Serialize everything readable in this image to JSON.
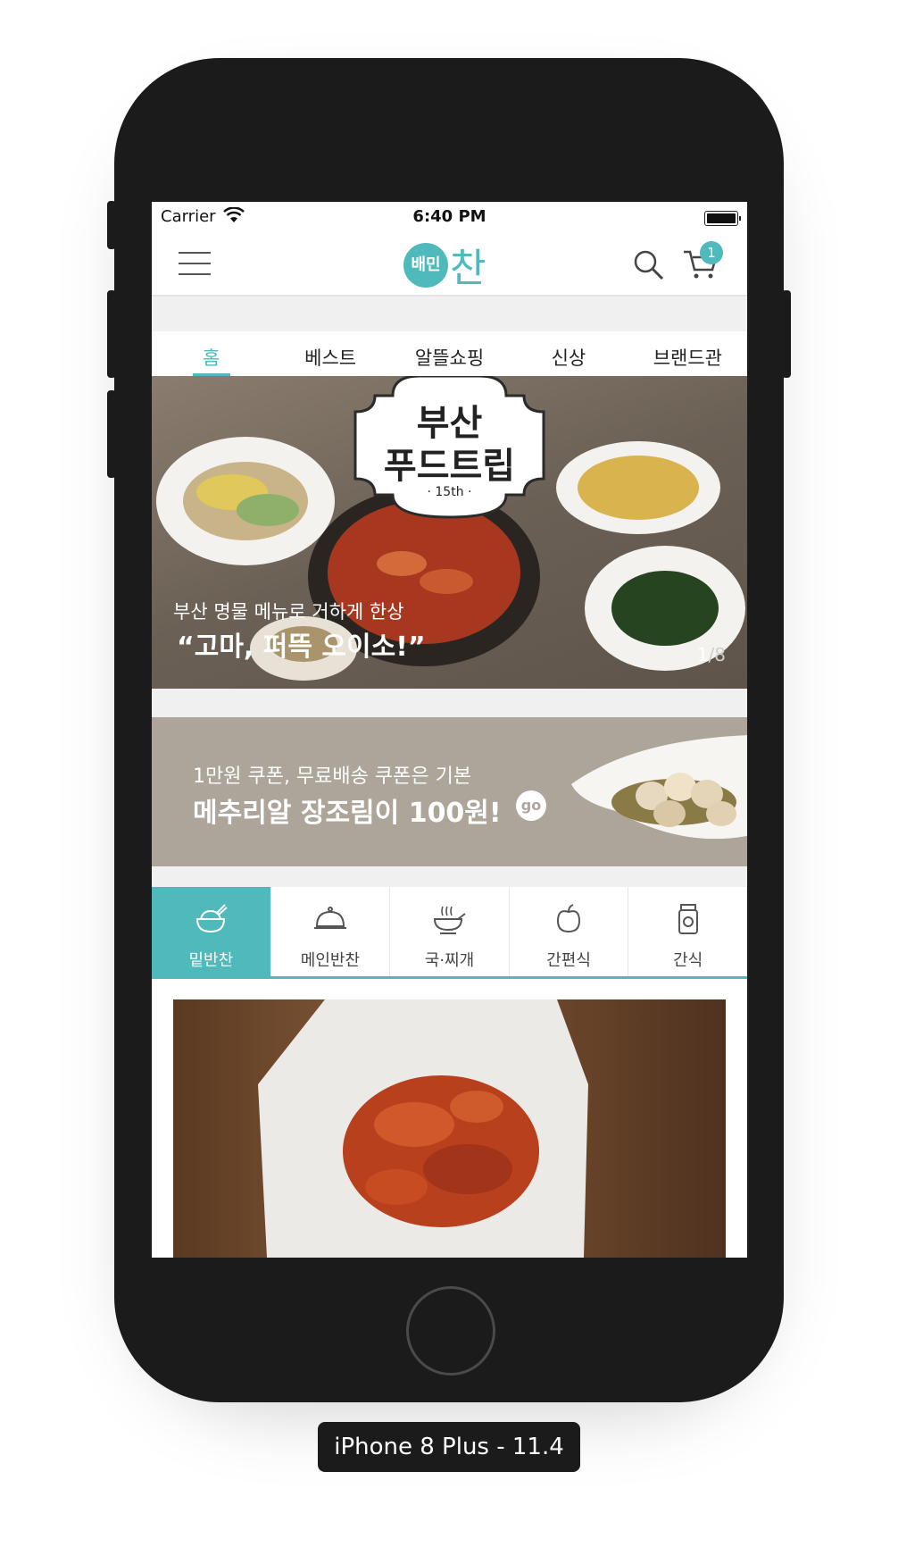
{
  "status": {
    "carrier": "Carrier",
    "time": "6:40 PM"
  },
  "header": {
    "logo_badge": "배민",
    "logo_text": "찬",
    "cart_count": "1"
  },
  "tabs": [
    {
      "label": "홈"
    },
    {
      "label": "베스트"
    },
    {
      "label": "알뜰쇼핑"
    },
    {
      "label": "신상"
    },
    {
      "label": "브랜드관"
    }
  ],
  "hero": {
    "badge_line1": "부산",
    "badge_line2": "푸드트립",
    "badge_edition": "· 15th ·",
    "subtitle": "부산 명물 메뉴로 거하게 한상",
    "title": "“고마, 퍼뜩 오이소!”",
    "current": "1",
    "total": "/8"
  },
  "promo": {
    "subtitle": "1만원 쿠폰, 무료배송 쿠폰은 기본",
    "title": "메추리알 장조림이 100원!",
    "go": "go"
  },
  "categories": [
    {
      "label": "밑반찬",
      "icon": "rice-bowl-icon"
    },
    {
      "label": "메인반찬",
      "icon": "cloche-icon"
    },
    {
      "label": "국·찌개",
      "icon": "soup-bowl-icon"
    },
    {
      "label": "간편식",
      "icon": "apple-icon"
    },
    {
      "label": "간식",
      "icon": "jar-icon"
    }
  ],
  "device_label": "iPhone 8 Plus - 11.4",
  "colors": {
    "accent": "#4fb9bb",
    "promo_bg": "#ada49a",
    "phone": "#1b1b1b"
  }
}
